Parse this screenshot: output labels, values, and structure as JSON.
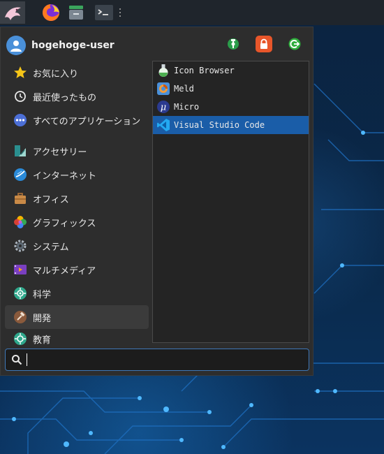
{
  "user": {
    "name": "hogehoge-user"
  },
  "actions": [
    {
      "name": "settings-icon",
      "color": "#2a9d4a"
    },
    {
      "name": "lock-icon",
      "color": "#e8562a"
    },
    {
      "name": "logout-icon",
      "color": "#2fae3c"
    }
  ],
  "categories": {
    "favorites": "お気に入り",
    "recent": "最近使ったもの",
    "all_apps": "すべてのアプリケーション",
    "accessories": "アクセサリー",
    "internet": "インターネット",
    "office": "オフィス",
    "graphics": "グラフィックス",
    "system": "システム",
    "multimedia": "マルチメディア",
    "science": "科学",
    "development": "開発",
    "education": "教育"
  },
  "apps": [
    {
      "label": "Icon Browser",
      "icon": "flask-icon"
    },
    {
      "label": "Meld",
      "icon": "meld-icon"
    },
    {
      "label": "Micro",
      "icon": "micro-icon"
    },
    {
      "label": "Visual Studio Code",
      "icon": "vscode-icon"
    }
  ],
  "search": {
    "value": "",
    "placeholder": ""
  },
  "colors": {
    "selection": "#1a5da8",
    "menu_bg": "#2d2d2d",
    "accent_border": "#3f78b8"
  }
}
